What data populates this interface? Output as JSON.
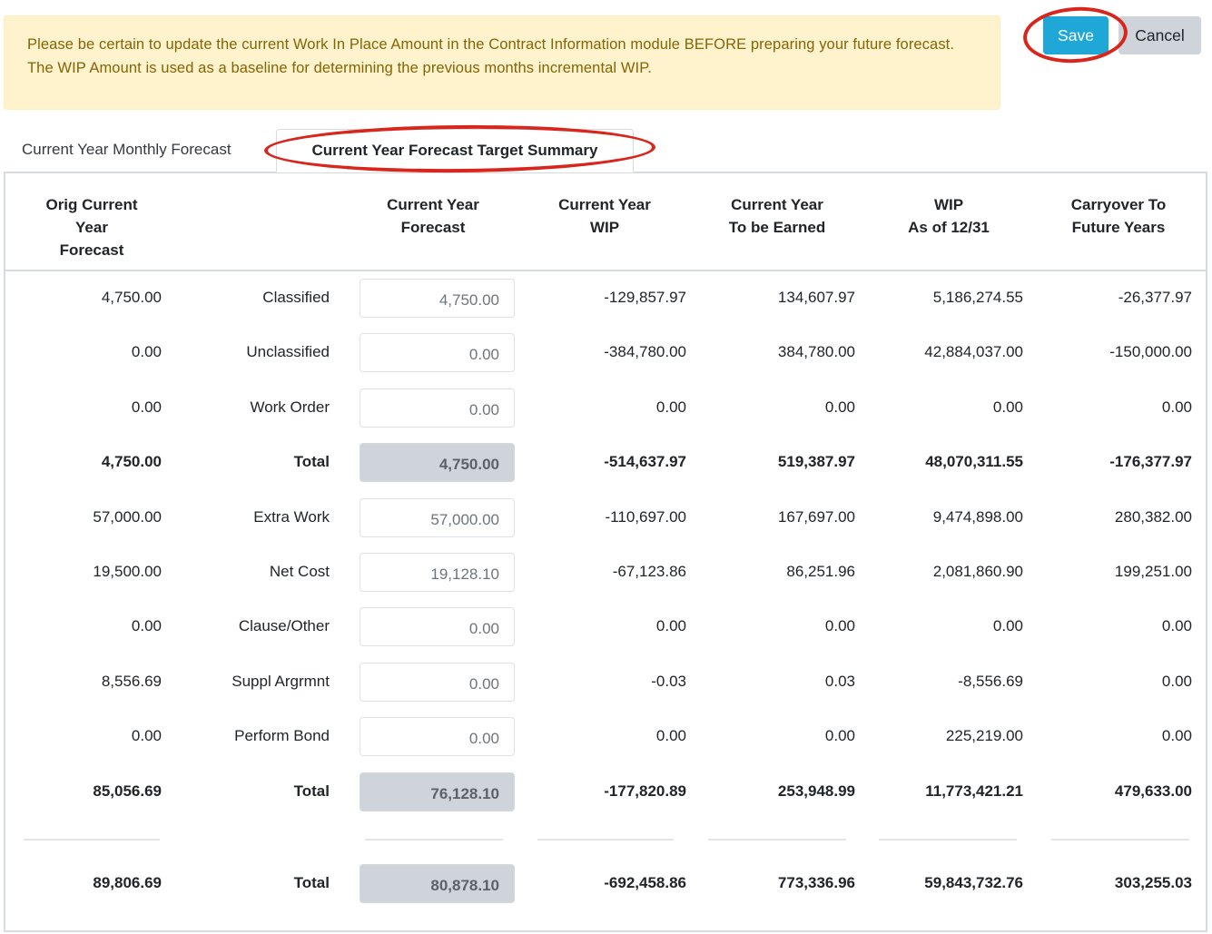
{
  "alert": {
    "message": "Please be certain to update the current Work In Place Amount in the Contract Information module BEFORE preparing your future forecast. The WIP Amount is used as a baseline for determining the previous months incremental WIP."
  },
  "actions": {
    "save_label": "Save",
    "cancel_label": "Cancel"
  },
  "tabs": [
    {
      "label": "Current Year Monthly Forecast",
      "active": false
    },
    {
      "label": "Current Year Forecast Target Summary",
      "active": true
    }
  ],
  "columns": {
    "orig": [
      "Orig Current",
      "Year",
      "Forecast"
    ],
    "forecast": [
      "Current Year",
      "Forecast"
    ],
    "wip": [
      "Current Year",
      "WIP"
    ],
    "earn": [
      "Current Year",
      "To be Earned"
    ],
    "asof": [
      "WIP",
      "As of 12/31"
    ],
    "carry": [
      "Carryover To",
      "Future Years"
    ]
  },
  "rows": [
    {
      "orig": "4,750.00",
      "label": "Classified",
      "forecast": "4,750.00",
      "wip": "-129,857.97",
      "earn": "134,607.97",
      "asof": "5,186,274.55",
      "carry": "-26,377.97"
    },
    {
      "orig": "0.00",
      "label": "Unclassified",
      "forecast": "0.00",
      "wip": "-384,780.00",
      "earn": "384,780.00",
      "asof": "42,884,037.00",
      "carry": "-150,000.00"
    },
    {
      "orig": "0.00",
      "label": "Work Order",
      "forecast": "0.00",
      "wip": "0.00",
      "earn": "0.00",
      "asof": "0.00",
      "carry": "0.00"
    },
    {
      "orig": "4,750.00",
      "label": "Total",
      "forecast": "4,750.00",
      "wip": "-514,637.97",
      "earn": "519,387.97",
      "asof": "48,070,311.55",
      "carry": "-176,377.97"
    },
    {
      "orig": "57,000.00",
      "label": "Extra Work",
      "forecast": "57,000.00",
      "wip": "-110,697.00",
      "earn": "167,697.00",
      "asof": "9,474,898.00",
      "carry": "280,382.00"
    },
    {
      "orig": "19,500.00",
      "label": "Net Cost",
      "forecast": "19,128.10",
      "wip": "-67,123.86",
      "earn": "86,251.96",
      "asof": "2,081,860.90",
      "carry": "199,251.00"
    },
    {
      "orig": "0.00",
      "label": "Clause/Other",
      "forecast": "0.00",
      "wip": "0.00",
      "earn": "0.00",
      "asof": "0.00",
      "carry": "0.00"
    },
    {
      "orig": "8,556.69",
      "label": "Suppl Argrmnt",
      "forecast": "0.00",
      "wip": "-0.03",
      "earn": "0.03",
      "asof": "-8,556.69",
      "carry": "0.00"
    },
    {
      "orig": "0.00",
      "label": "Perform Bond",
      "forecast": "0.00",
      "wip": "0.00",
      "earn": "0.00",
      "asof": "225,219.00",
      "carry": "0.00"
    },
    {
      "orig": "85,056.69",
      "label": "Total",
      "forecast": "76,128.10",
      "wip": "-177,820.89",
      "earn": "253,948.99",
      "asof": "11,773,421.21",
      "carry": "479,633.00"
    }
  ],
  "grand_total": {
    "orig": "89,806.69",
    "label": "Total",
    "forecast": "80,878.10",
    "wip": "-692,458.86",
    "earn": "773,336.96",
    "asof": "59,843,732.76",
    "carry": "303,255.03"
  }
}
